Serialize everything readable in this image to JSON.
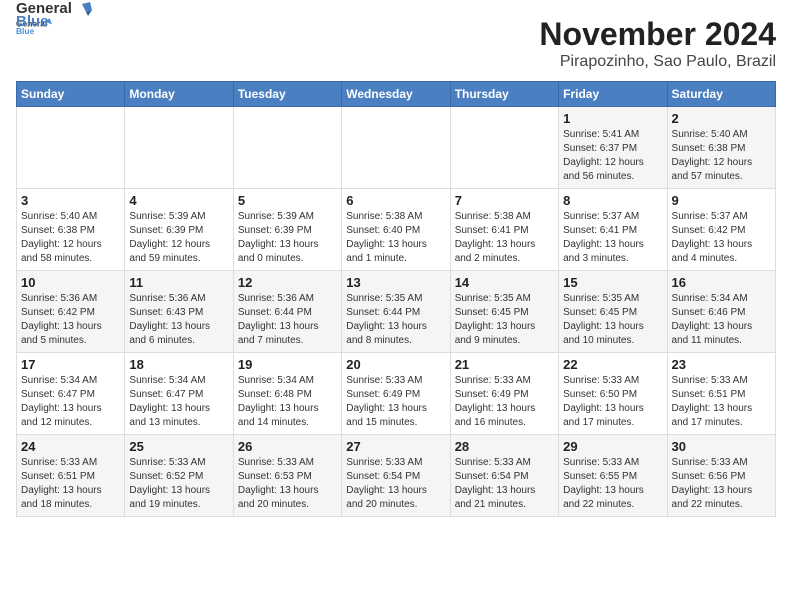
{
  "header": {
    "logo_line1": "General",
    "logo_line2": "Blue",
    "title": "November 2024",
    "subtitle": "Pirapozinho, Sao Paulo, Brazil"
  },
  "weekdays": [
    "Sunday",
    "Monday",
    "Tuesday",
    "Wednesday",
    "Thursday",
    "Friday",
    "Saturday"
  ],
  "weeks": [
    [
      {
        "day": "",
        "content": ""
      },
      {
        "day": "",
        "content": ""
      },
      {
        "day": "",
        "content": ""
      },
      {
        "day": "",
        "content": ""
      },
      {
        "day": "",
        "content": ""
      },
      {
        "day": "1",
        "content": "Sunrise: 5:41 AM\nSunset: 6:37 PM\nDaylight: 12 hours\nand 56 minutes."
      },
      {
        "day": "2",
        "content": "Sunrise: 5:40 AM\nSunset: 6:38 PM\nDaylight: 12 hours\nand 57 minutes."
      }
    ],
    [
      {
        "day": "3",
        "content": "Sunrise: 5:40 AM\nSunset: 6:38 PM\nDaylight: 12 hours\nand 58 minutes."
      },
      {
        "day": "4",
        "content": "Sunrise: 5:39 AM\nSunset: 6:39 PM\nDaylight: 12 hours\nand 59 minutes."
      },
      {
        "day": "5",
        "content": "Sunrise: 5:39 AM\nSunset: 6:39 PM\nDaylight: 13 hours\nand 0 minutes."
      },
      {
        "day": "6",
        "content": "Sunrise: 5:38 AM\nSunset: 6:40 PM\nDaylight: 13 hours\nand 1 minute."
      },
      {
        "day": "7",
        "content": "Sunrise: 5:38 AM\nSunset: 6:41 PM\nDaylight: 13 hours\nand 2 minutes."
      },
      {
        "day": "8",
        "content": "Sunrise: 5:37 AM\nSunset: 6:41 PM\nDaylight: 13 hours\nand 3 minutes."
      },
      {
        "day": "9",
        "content": "Sunrise: 5:37 AM\nSunset: 6:42 PM\nDaylight: 13 hours\nand 4 minutes."
      }
    ],
    [
      {
        "day": "10",
        "content": "Sunrise: 5:36 AM\nSunset: 6:42 PM\nDaylight: 13 hours\nand 5 minutes."
      },
      {
        "day": "11",
        "content": "Sunrise: 5:36 AM\nSunset: 6:43 PM\nDaylight: 13 hours\nand 6 minutes."
      },
      {
        "day": "12",
        "content": "Sunrise: 5:36 AM\nSunset: 6:44 PM\nDaylight: 13 hours\nand 7 minutes."
      },
      {
        "day": "13",
        "content": "Sunrise: 5:35 AM\nSunset: 6:44 PM\nDaylight: 13 hours\nand 8 minutes."
      },
      {
        "day": "14",
        "content": "Sunrise: 5:35 AM\nSunset: 6:45 PM\nDaylight: 13 hours\nand 9 minutes."
      },
      {
        "day": "15",
        "content": "Sunrise: 5:35 AM\nSunset: 6:45 PM\nDaylight: 13 hours\nand 10 minutes."
      },
      {
        "day": "16",
        "content": "Sunrise: 5:34 AM\nSunset: 6:46 PM\nDaylight: 13 hours\nand 11 minutes."
      }
    ],
    [
      {
        "day": "17",
        "content": "Sunrise: 5:34 AM\nSunset: 6:47 PM\nDaylight: 13 hours\nand 12 minutes."
      },
      {
        "day": "18",
        "content": "Sunrise: 5:34 AM\nSunset: 6:47 PM\nDaylight: 13 hours\nand 13 minutes."
      },
      {
        "day": "19",
        "content": "Sunrise: 5:34 AM\nSunset: 6:48 PM\nDaylight: 13 hours\nand 14 minutes."
      },
      {
        "day": "20",
        "content": "Sunrise: 5:33 AM\nSunset: 6:49 PM\nDaylight: 13 hours\nand 15 minutes."
      },
      {
        "day": "21",
        "content": "Sunrise: 5:33 AM\nSunset: 6:49 PM\nDaylight: 13 hours\nand 16 minutes."
      },
      {
        "day": "22",
        "content": "Sunrise: 5:33 AM\nSunset: 6:50 PM\nDaylight: 13 hours\nand 17 minutes."
      },
      {
        "day": "23",
        "content": "Sunrise: 5:33 AM\nSunset: 6:51 PM\nDaylight: 13 hours\nand 17 minutes."
      }
    ],
    [
      {
        "day": "24",
        "content": "Sunrise: 5:33 AM\nSunset: 6:51 PM\nDaylight: 13 hours\nand 18 minutes."
      },
      {
        "day": "25",
        "content": "Sunrise: 5:33 AM\nSunset: 6:52 PM\nDaylight: 13 hours\nand 19 minutes."
      },
      {
        "day": "26",
        "content": "Sunrise: 5:33 AM\nSunset: 6:53 PM\nDaylight: 13 hours\nand 20 minutes."
      },
      {
        "day": "27",
        "content": "Sunrise: 5:33 AM\nSunset: 6:54 PM\nDaylight: 13 hours\nand 20 minutes."
      },
      {
        "day": "28",
        "content": "Sunrise: 5:33 AM\nSunset: 6:54 PM\nDaylight: 13 hours\nand 21 minutes."
      },
      {
        "day": "29",
        "content": "Sunrise: 5:33 AM\nSunset: 6:55 PM\nDaylight: 13 hours\nand 22 minutes."
      },
      {
        "day": "30",
        "content": "Sunrise: 5:33 AM\nSunset: 6:56 PM\nDaylight: 13 hours\nand 22 minutes."
      }
    ]
  ]
}
